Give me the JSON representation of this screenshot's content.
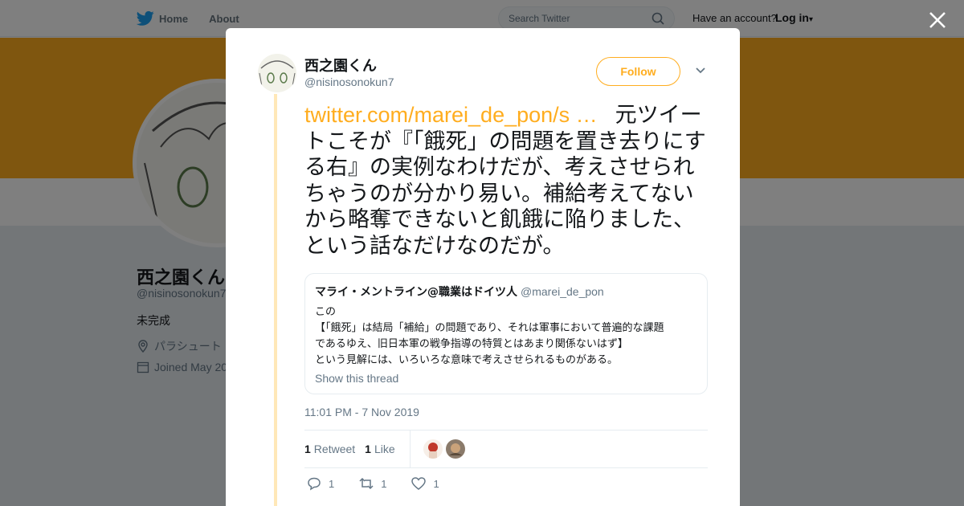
{
  "nav": {
    "home": "Home",
    "about": "About",
    "search_placeholder": "Search Twitter",
    "have_account": "Have an account?",
    "login": "Log in"
  },
  "profile": {
    "name": "西之園くん",
    "handle": "@nisinosonokun7",
    "bio": "未完成",
    "location": "パラシュート",
    "joined": "Joined May 20"
  },
  "tweet": {
    "author_name": "西之園くん",
    "author_handle": "@nisinosonokun7",
    "follow_label": "Follow",
    "link_text": "twitter.com/marei_de_pon/s …",
    "body": "元ツイートこそが『「餓死」の問題を置き去りにする右』の実例なわけだが、考えさせられちゃうのが分かり易い。補給考えてないから略奪できないと飢餓に陥りました、という話なだけなのだが。",
    "timestamp": "11:01 PM - 7 Nov 2019",
    "retweet_count": "1",
    "retweet_label": "Retweet",
    "like_count": "1",
    "like_label": "Like",
    "reply_action_count": "1",
    "retweet_action_count": "1",
    "like_action_count": "1"
  },
  "quote": {
    "name": "マライ・メントライン@職業はドイツ人",
    "handle": "@marei_de_pon",
    "lines": [
      "この",
      "【「餓死」は結局「補給」の問題であり、それは軍事において普遍的な課題",
      "であるゆえ、旧日本軍の戦争指導の特質とはあまり関係ないはず】",
      "という見解には、いろいろな意味で考えさせられるものがある。"
    ],
    "show_thread": "Show this thread"
  },
  "colors": {
    "accent": "#ffad1f",
    "text_secondary": "#657786",
    "border": "#e6ecf0"
  }
}
